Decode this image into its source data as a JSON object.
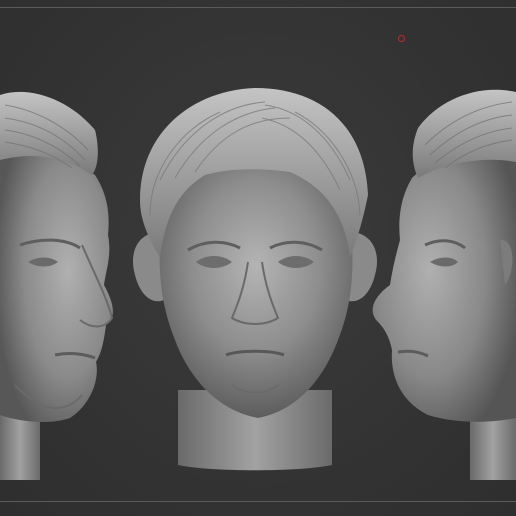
{
  "scene": {
    "background_color": "#353535",
    "frame_line_color": "#5a5a5a",
    "marker_color": "#c0262b",
    "clay_color": "#9a9a9a",
    "views": [
      "left-three-quarter",
      "front",
      "right-profile"
    ]
  }
}
